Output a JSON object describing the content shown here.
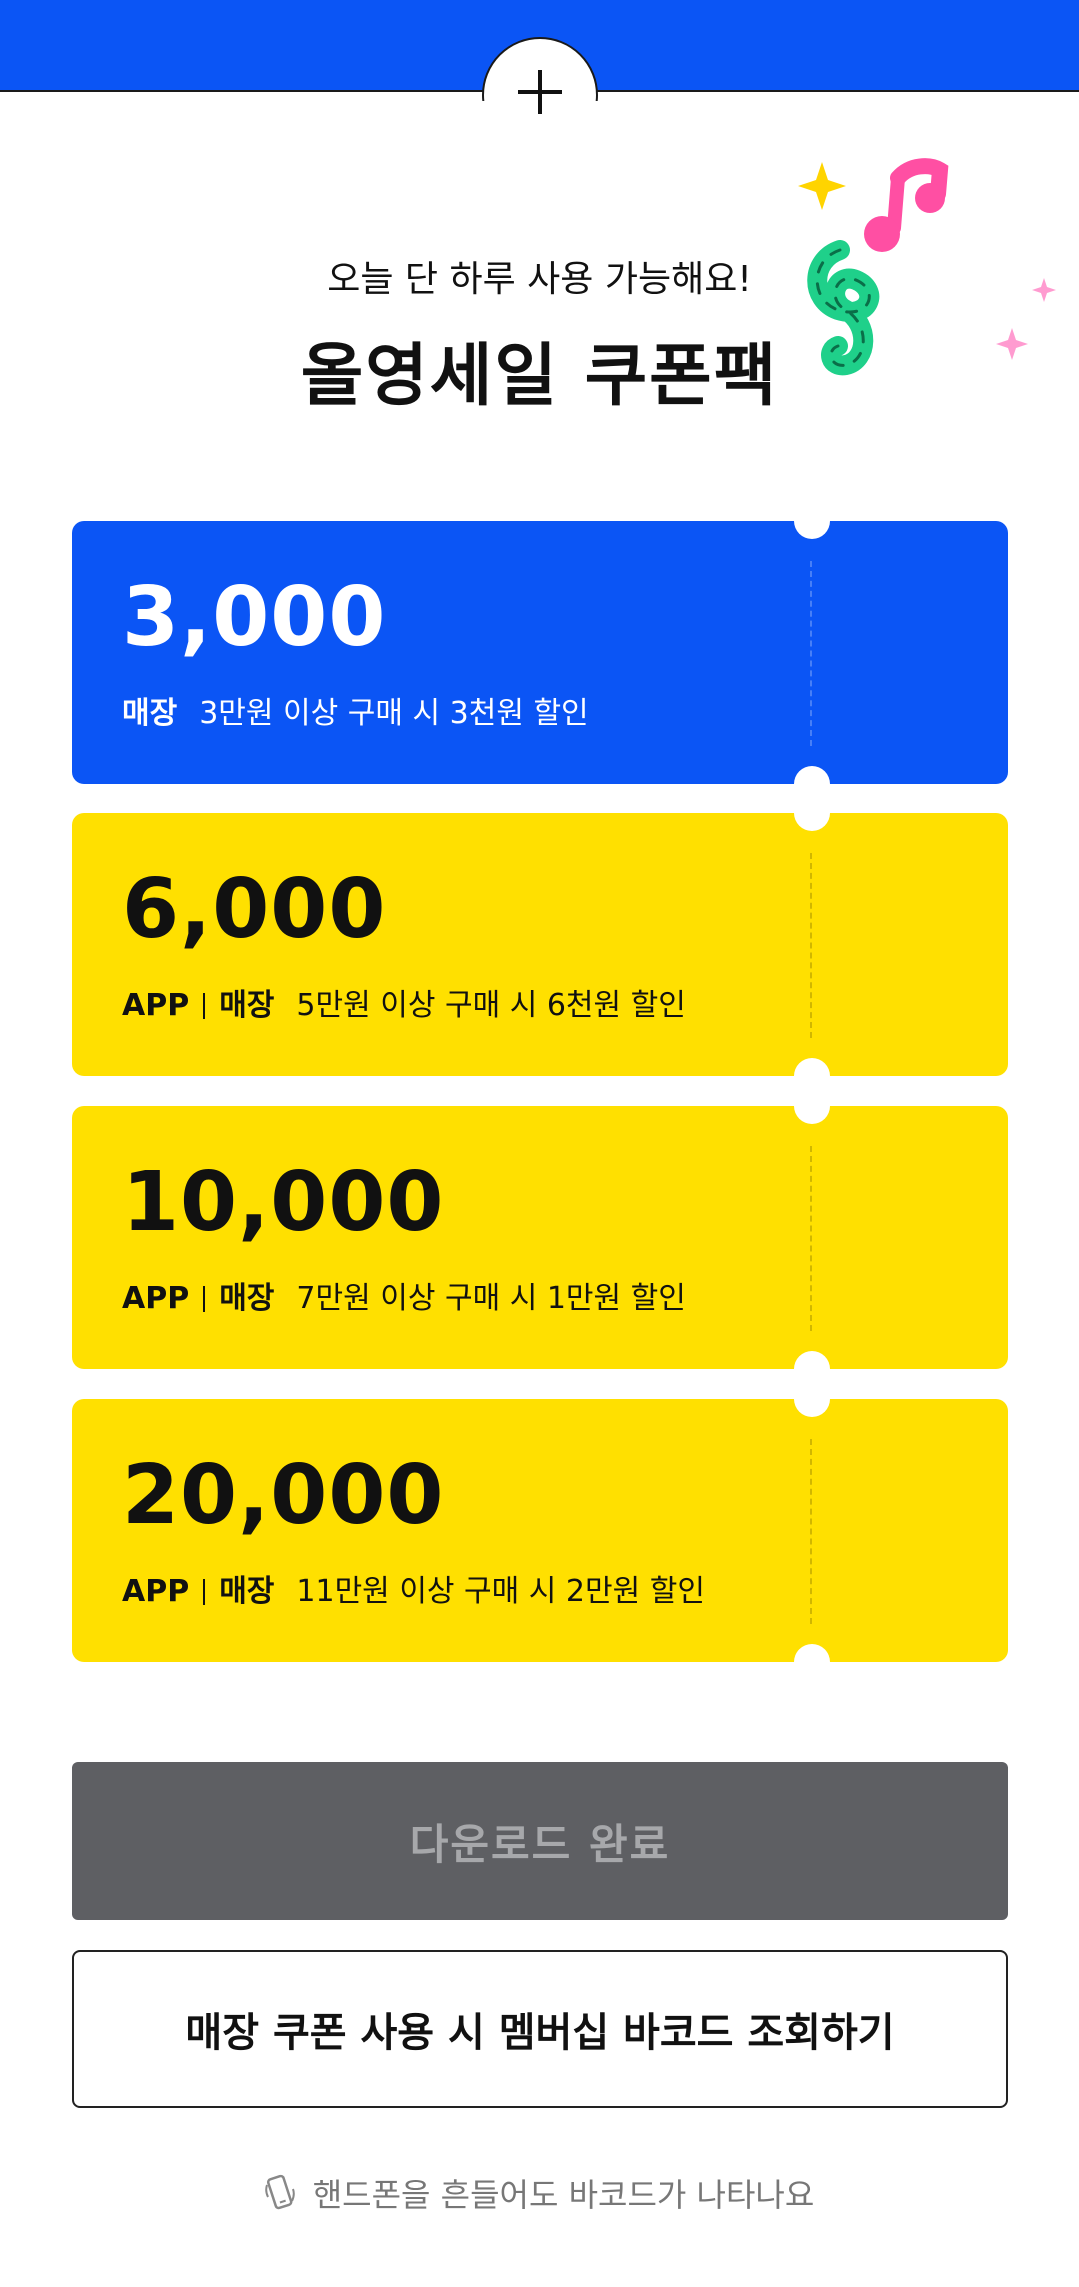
{
  "header": {
    "subtitle": "오늘 단 하루 사용 가능해요!",
    "title": "올영세일 쿠폰팩",
    "plus_icon": "plus-icon",
    "decoration_icon": "music-notes-sparkles-icon"
  },
  "coupons": [
    {
      "amount": "3,000",
      "channels": [
        "매장"
      ],
      "condition": "3만원 이상 구매 시 3천원 할인",
      "style": "blue"
    },
    {
      "amount": "6,000",
      "channels": [
        "APP",
        "매장"
      ],
      "condition": "5만원 이상 구매 시 6천원 할인",
      "style": "yellow"
    },
    {
      "amount": "10,000",
      "channels": [
        "APP",
        "매장"
      ],
      "condition": "7만원 이상 구매 시 1만원 할인",
      "style": "yellow"
    },
    {
      "amount": "20,000",
      "channels": [
        "APP",
        "매장"
      ],
      "condition": "11만원 이상 구매 시 2만원 할인",
      "style": "yellow"
    }
  ],
  "buttons": {
    "download_done": "다운로드 완료",
    "barcode": "매장 쿠폰 사용 시 멤버십 바코드 조회하기"
  },
  "hint": {
    "icon": "shake-phone-icon",
    "text": "핸드폰을 흔들어도 바코드가 나타나요"
  },
  "colors": {
    "brand_blue": "#0b55f5",
    "coupon_yellow": "#ffe000",
    "disabled_button": "#5e5f63"
  }
}
